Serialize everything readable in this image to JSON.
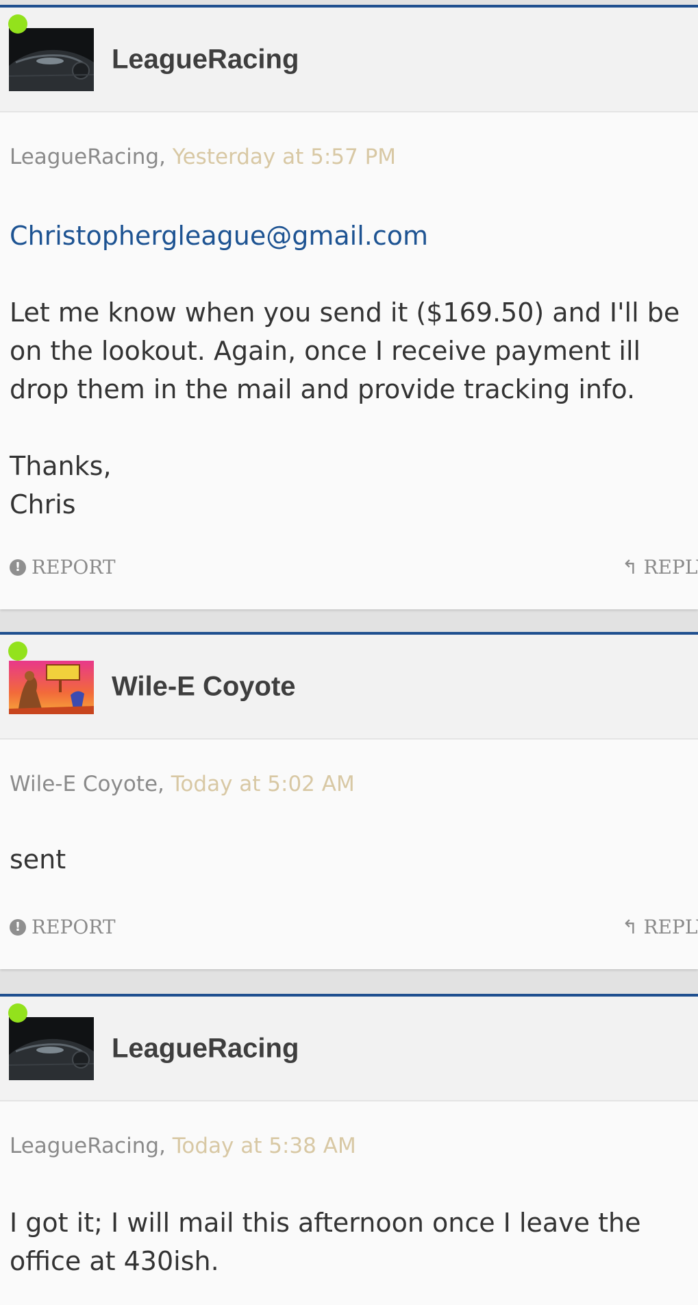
{
  "posts": [
    {
      "username": "LeagueRacing",
      "meta_author": "LeagueRacing,",
      "meta_time": "Yesterday at 5:57 PM",
      "email": "Christophergleague@gmail.com",
      "paragraph1_line1": "Let me know when you send it ($169.50) and I'll be",
      "paragraph1_line2": "on the lookout. Again, once I receive payment ill",
      "paragraph1_line3": "drop them in the mail and provide tracking info.",
      "sign_line1": "Thanks,",
      "sign_line2": "Chris",
      "report_label": "REPORT",
      "reply_label": "REPLY"
    },
    {
      "username": "Wile-E Coyote",
      "meta_author": "Wile-E Coyote,",
      "meta_time": "Today at 5:02 AM",
      "text": "sent",
      "report_label": "REPORT",
      "reply_label": "REPLY"
    },
    {
      "username": "LeagueRacing",
      "meta_author": "LeagueRacing,",
      "meta_time": "Today at 5:38 AM",
      "line1": "I got it; I will mail this afternoon once I leave the",
      "line2": "office at 430ish."
    }
  ],
  "colors": {
    "accent_border": "#1f4f8f",
    "online": "#93e21c",
    "timestamp": "#d8c8a4",
    "link": "#1d5392"
  },
  "icons": [
    "report-icon",
    "reply-icon"
  ]
}
